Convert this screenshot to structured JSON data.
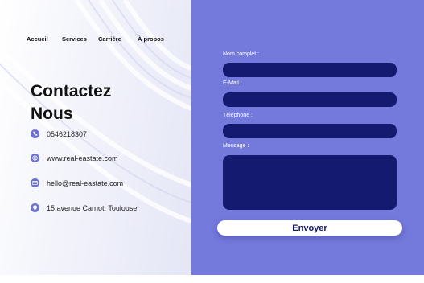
{
  "nav": {
    "items": [
      "Accueil",
      "Services",
      "Carrière",
      "À propos"
    ]
  },
  "contact": {
    "title_line1": "Contactez",
    "title_line2": "Nous",
    "phone": "0546218307",
    "website": "www.real-eastate.com",
    "email": "hello@real-eastate.com",
    "address": "15 avenue Carnot, Toulouse"
  },
  "form": {
    "name_label": "Nom complet :",
    "email_label": "E-Mail  :",
    "phone_label": "Téléphone :",
    "message_label": "Message :",
    "submit_label": "Envoyer"
  },
  "colors": {
    "panel": "#7479dc",
    "field": "#131a6f",
    "icon": "#6d72cf"
  }
}
